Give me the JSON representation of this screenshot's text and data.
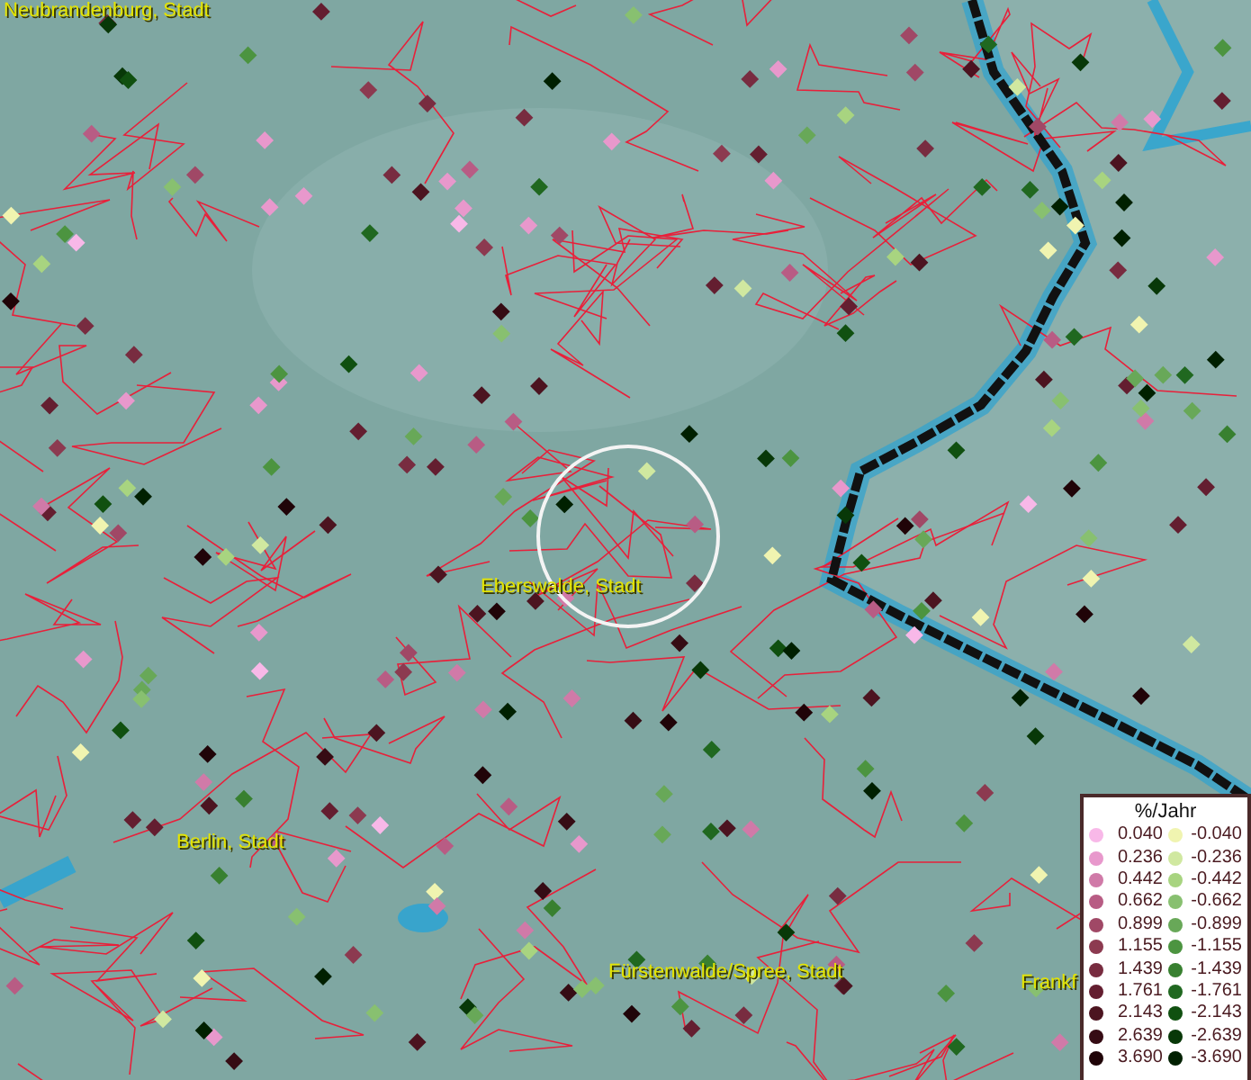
{
  "map": {
    "places": [
      {
        "name": "Neubrandenburg, Stadt"
      },
      {
        "name": "Eberswalde, Stadt"
      },
      {
        "name": "Berlin, Stadt"
      },
      {
        "name": "Fürstenwalde/Spree, Stadt"
      },
      {
        "name": "Frankf"
      }
    ]
  },
  "legend": {
    "title": "%/Jahr",
    "columns": [
      {
        "entries": [
          {
            "label": "0.040",
            "color": "#f8b8e8"
          },
          {
            "label": "0.236",
            "color": "#e898cc"
          },
          {
            "label": "0.442",
            "color": "#d07aa8"
          },
          {
            "label": "0.662",
            "color": "#b85c84"
          },
          {
            "label": "0.899",
            "color": "#a04866"
          },
          {
            "label": "1.155",
            "color": "#8c3a50"
          },
          {
            "label": "1.439",
            "color": "#782c40"
          },
          {
            "label": "1.761",
            "color": "#641e30"
          },
          {
            "label": "2.143",
            "color": "#4c1420"
          },
          {
            "label": "2.639",
            "color": "#360c14"
          },
          {
            "label": "3.690",
            "color": "#200408"
          }
        ]
      },
      {
        "entries": [
          {
            "label": "-0.040",
            "color": "#f0f4b0"
          },
          {
            "label": "-0.236",
            "color": "#d0e8a0"
          },
          {
            "label": "-0.442",
            "color": "#a8d480"
          },
          {
            "label": "-0.662",
            "color": "#88c070"
          },
          {
            "label": "-0.899",
            "color": "#68a858"
          },
          {
            "label": "-1.155",
            "color": "#4c9440"
          },
          {
            "label": "-1.439",
            "color": "#388030"
          },
          {
            "label": "-1.761",
            "color": "#206820"
          },
          {
            "label": "-2.143",
            "color": "#105010"
          },
          {
            "label": "-2.639",
            "color": "#083808"
          },
          {
            "label": "-3.690",
            "color": "#002000"
          }
        ]
      }
    ]
  }
}
